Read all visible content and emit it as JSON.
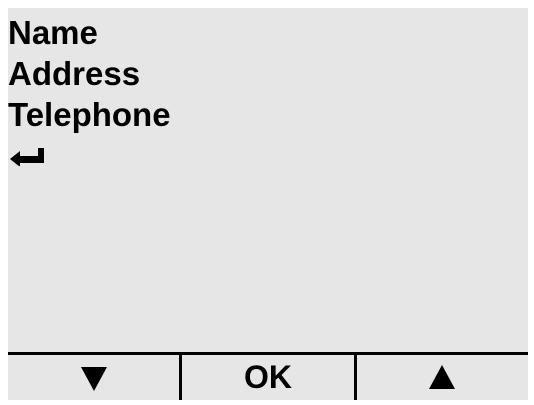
{
  "menu": {
    "items": [
      "Name",
      "Address",
      "Telephone"
    ],
    "enter_icon": "return-arrow-icon"
  },
  "softkeys": {
    "left_icon": "down-triangle-icon",
    "center_label": "OK",
    "right_icon": "up-triangle-icon"
  },
  "colors": {
    "screen_background": "#e6e6e6",
    "foreground": "#000000",
    "page_background": "#ffffff"
  }
}
